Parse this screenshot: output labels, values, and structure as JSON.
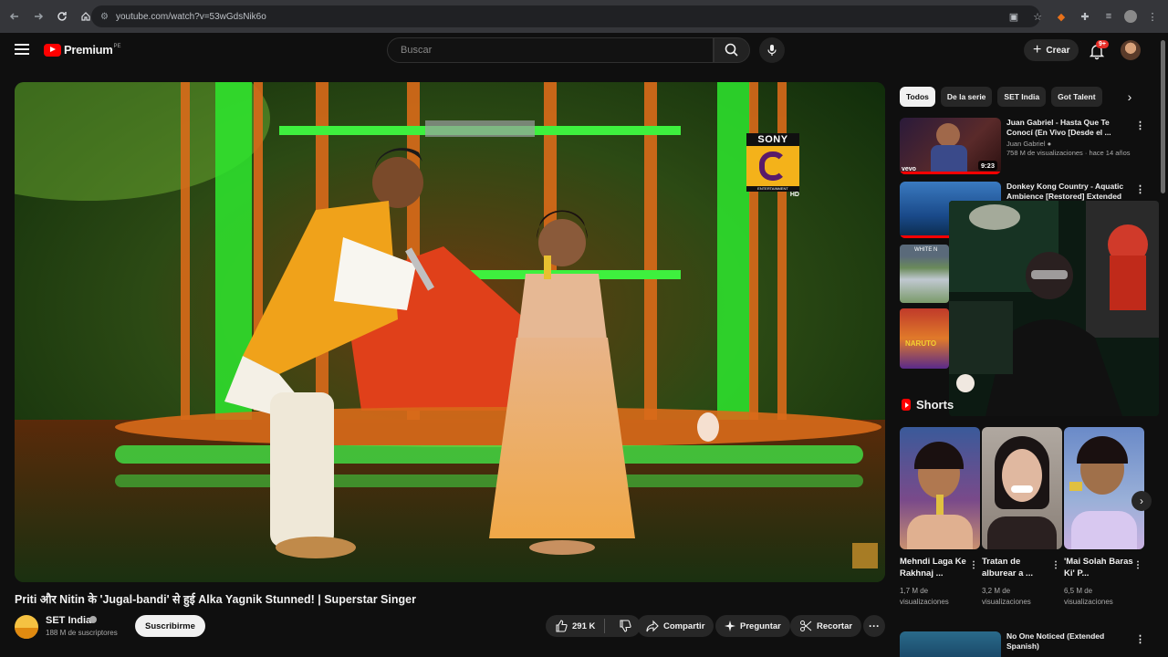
{
  "browser": {
    "url": "youtube.com/watch?v=53wGdsNik6o",
    "icons": [
      "back-icon",
      "forward-icon",
      "reload-icon",
      "home-icon",
      "site-settings-icon",
      "install-app-icon",
      "bookmark-star-icon",
      "extension-fox-icon",
      "extensions-puzzle-icon",
      "media-control-icon",
      "profile-avatar-icon",
      "browser-menu-icon"
    ]
  },
  "header": {
    "logo_text": "Premium",
    "logo_sup": "PE",
    "search_placeholder": "Buscar",
    "create_label": "Crear",
    "notification_count": "9+"
  },
  "video": {
    "title": "Priti और Nitin के 'Jugal-bandi' से हुई Alka Yagnik Stunned! | Superstar Singer",
    "watermark": "SONY",
    "watermark_sub": "ENTERTAINMENT TELEVISION",
    "watermark_hd": "HD"
  },
  "channel": {
    "name": "SET India",
    "subscribers": "188 M de suscriptores",
    "subscribe_label": "Suscribirme"
  },
  "actions": {
    "likes": "291 K",
    "share": "Compartir",
    "ask": "Preguntar",
    "clip": "Recortar"
  },
  "chips": [
    "Todos",
    "De la serie",
    "SET India",
    "Got Talent"
  ],
  "recommendations": [
    {
      "title": "Juan Gabriel - Hasta Que Te Conocí (En Vivo [Desde el ...",
      "channel": "Juan Gabriel",
      "meta": "758 M de visualizaciones · hace 14 años",
      "duration": "9:23",
      "thumb_label": "vevo"
    },
    {
      "title": "Donkey Kong Country - Aquatic Ambience [Restored] Extended"
    },
    {
      "title": "No One Noticed (Extended Spanish)"
    }
  ],
  "small_thumbs": [
    {
      "label": "WHITE N"
    },
    {
      "label": ""
    },
    {
      "label": "NARUTO"
    }
  ],
  "shorts": {
    "heading": "Shorts",
    "items": [
      {
        "title": "Mehndi Laga Ke Rakhnaj ...",
        "views": "1,7 M de visualizaciones"
      },
      {
        "title": "Tratan de alburear a ...",
        "views": "3,2 M de visualizaciones"
      },
      {
        "title": "'Mai Solah Baras Ki' P...",
        "views": "6,5 M de visualizaciones"
      }
    ]
  },
  "colors": {
    "background": "#0f0f0f",
    "accent": "#ff0000",
    "chip": "#272727"
  }
}
